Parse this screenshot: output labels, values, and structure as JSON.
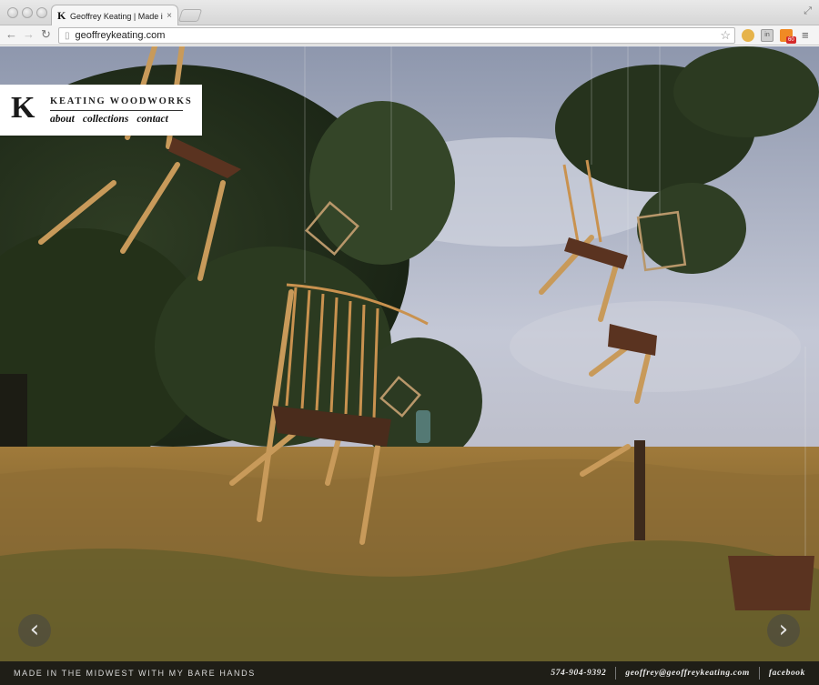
{
  "browser": {
    "tab_favicon": "K",
    "tab_title": "Geoffrey Keating | Made in",
    "tab_close": "×",
    "url": "geoffreykeating.com",
    "ext_badge_count": "60",
    "ext_label": "in"
  },
  "site": {
    "brand_letter": "K",
    "brand_name": "KEATING WOODWORKS",
    "nav": [
      "about",
      "collections",
      "contact"
    ]
  },
  "footer": {
    "tagline": "MADE IN THE MIDWEST WITH MY BARE HANDS",
    "phone": "574-904-9392",
    "email": "geoffrey@geoffreykeating.com",
    "social": "facebook"
  },
  "carousel": {
    "prev_glyph": "‹",
    "next_glyph": "›"
  },
  "icons": {
    "back": "arrow-left-icon",
    "forward": "arrow-right-icon",
    "reload": "reload-icon",
    "page": "page-icon",
    "star": "star-icon",
    "menu": "menu-icon"
  },
  "colors": {
    "footer_bg": "#141414",
    "brand_bg": "#ffffff",
    "sky": "#aab4c8",
    "field": "#8a6a2e"
  }
}
